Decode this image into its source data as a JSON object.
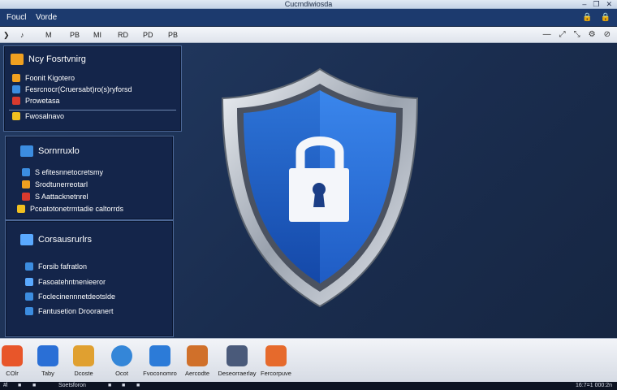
{
  "window": {
    "title": "Cucmdiwiosda",
    "controls": [
      "–",
      "❐",
      "✕"
    ]
  },
  "menubar": {
    "items": [
      "Foucl",
      "Vorde"
    ],
    "right_icons": [
      "🔒",
      "🔒"
    ]
  },
  "toolbar": {
    "items": [
      "❯",
      "♪",
      "M",
      "PB",
      "MI",
      "RD",
      "PD",
      "PB"
    ],
    "right_icons": [
      "—",
      "⤢",
      "⤡",
      "⚙",
      "⊘"
    ]
  },
  "panels": {
    "top": {
      "title": "Ncy Fosrtvnirg",
      "items": [
        {
          "label": "Foonit Kigotero",
          "color": "#f0a020"
        },
        {
          "label": "Fesrcnocr(Cruersabt)ro(s)ryforsd",
          "color": "#3c8de0"
        },
        {
          "label": "Prowetasa",
          "color": "#d93a2e"
        },
        {
          "label": "Fwosalnavo",
          "color": "#f0c020"
        }
      ]
    },
    "middle": {
      "title": "Sornrruxlo",
      "items": [
        {
          "label": "S efitesnnetocretsmy",
          "color": "#3c8de0"
        },
        {
          "label": "Srodtunerreotarl",
          "color": "#f0a020"
        },
        {
          "label": "S Aattacknetnrel",
          "color": "#d93a2e"
        },
        {
          "label": "Pcoatotonetrmtadie caltorrds",
          "color": "#f0c020"
        }
      ]
    },
    "bottom": {
      "title": "Corsausrurlrs",
      "items": [
        {
          "label": "Forsib fafratlon",
          "color": "#3c8de0"
        },
        {
          "label": "Fasoatehntnenieeror",
          "color": "#5aa9ff"
        },
        {
          "label": "Foclecinennnetdeotslde",
          "color": "#3c8de0"
        },
        {
          "label": "Fantusetion Drooranert",
          "color": "#3c8de0"
        }
      ]
    }
  },
  "dock": {
    "items": [
      {
        "label": "COlr",
        "color": "#e8562a"
      },
      {
        "label": "Taby",
        "color": "#2a6fd6"
      },
      {
        "label": "Dcoste",
        "color": "#e0a030"
      },
      {
        "label": "Ocot",
        "color": "#3486d8"
      },
      {
        "label": "Fvoconomro",
        "color": "#2c7bd8"
      },
      {
        "label": "Aercodte",
        "color": "#d0702a"
      },
      {
        "label": "Deseorraerlay",
        "color": "#4a5a7a"
      },
      {
        "label": "Fercorpuve",
        "color": "#e66a2c"
      }
    ]
  },
  "taskbar": {
    "left": [
      "#l",
      "■",
      "■",
      "Soetsforon",
      "■",
      "■",
      "■"
    ],
    "right": "16:7=1 000:2n"
  },
  "colors": {
    "accent": "#1e5fc4",
    "panel_bg": "#14254a",
    "shield_blue": "#1e63c8",
    "shield_metal": "#b8bec8"
  }
}
